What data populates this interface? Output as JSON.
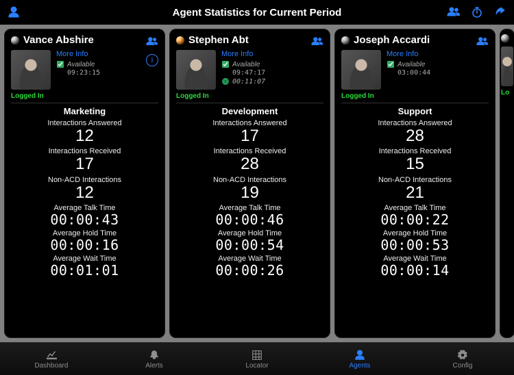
{
  "header": {
    "title": "Agent Statistics for Current Period"
  },
  "labels": {
    "more_info": "More Info",
    "available": "Available",
    "logged_in": "Logged In",
    "metrics": {
      "answered": "Interactions Answered",
      "received": "Interactions Received",
      "nonacd": "Non-ACD Interactions",
      "talk": "Average Talk Time",
      "hold": "Average Hold Time",
      "wait": "Average Wait Time"
    }
  },
  "agents": [
    {
      "name": "Vance Abshire",
      "status_color": "gray",
      "available_time": "09:23:15",
      "extra_time": null,
      "has_info_badge": true,
      "department": "Marketing",
      "answered": "12",
      "received": "17",
      "nonacd": "12",
      "talk": "00:00:43",
      "hold": "00:00:16",
      "wait": "00:01:01"
    },
    {
      "name": "Stephen Abt",
      "status_color": "orange",
      "available_time": "09:47:17",
      "extra_time": "00:11:07",
      "has_info_badge": false,
      "department": "Development",
      "answered": "17",
      "received": "28",
      "nonacd": "19",
      "talk": "00:00:46",
      "hold": "00:00:54",
      "wait": "00:00:26"
    },
    {
      "name": "Joseph Accardi",
      "status_color": "gray",
      "available_time": "03:00:44",
      "extra_time": null,
      "has_info_badge": false,
      "department": "Support",
      "answered": "28",
      "received": "15",
      "nonacd": "21",
      "talk": "00:00:22",
      "hold": "00:00:53",
      "wait": "00:00:14"
    }
  ],
  "peek": {
    "logged_in_prefix": "Lo"
  },
  "tabs": [
    {
      "id": "dashboard",
      "label": "Dashboard",
      "active": false
    },
    {
      "id": "alerts",
      "label": "Alerts",
      "active": false
    },
    {
      "id": "locator",
      "label": "Locator",
      "active": false
    },
    {
      "id": "agents",
      "label": "Agents",
      "active": true
    },
    {
      "id": "config",
      "label": "Config",
      "active": false
    }
  ]
}
